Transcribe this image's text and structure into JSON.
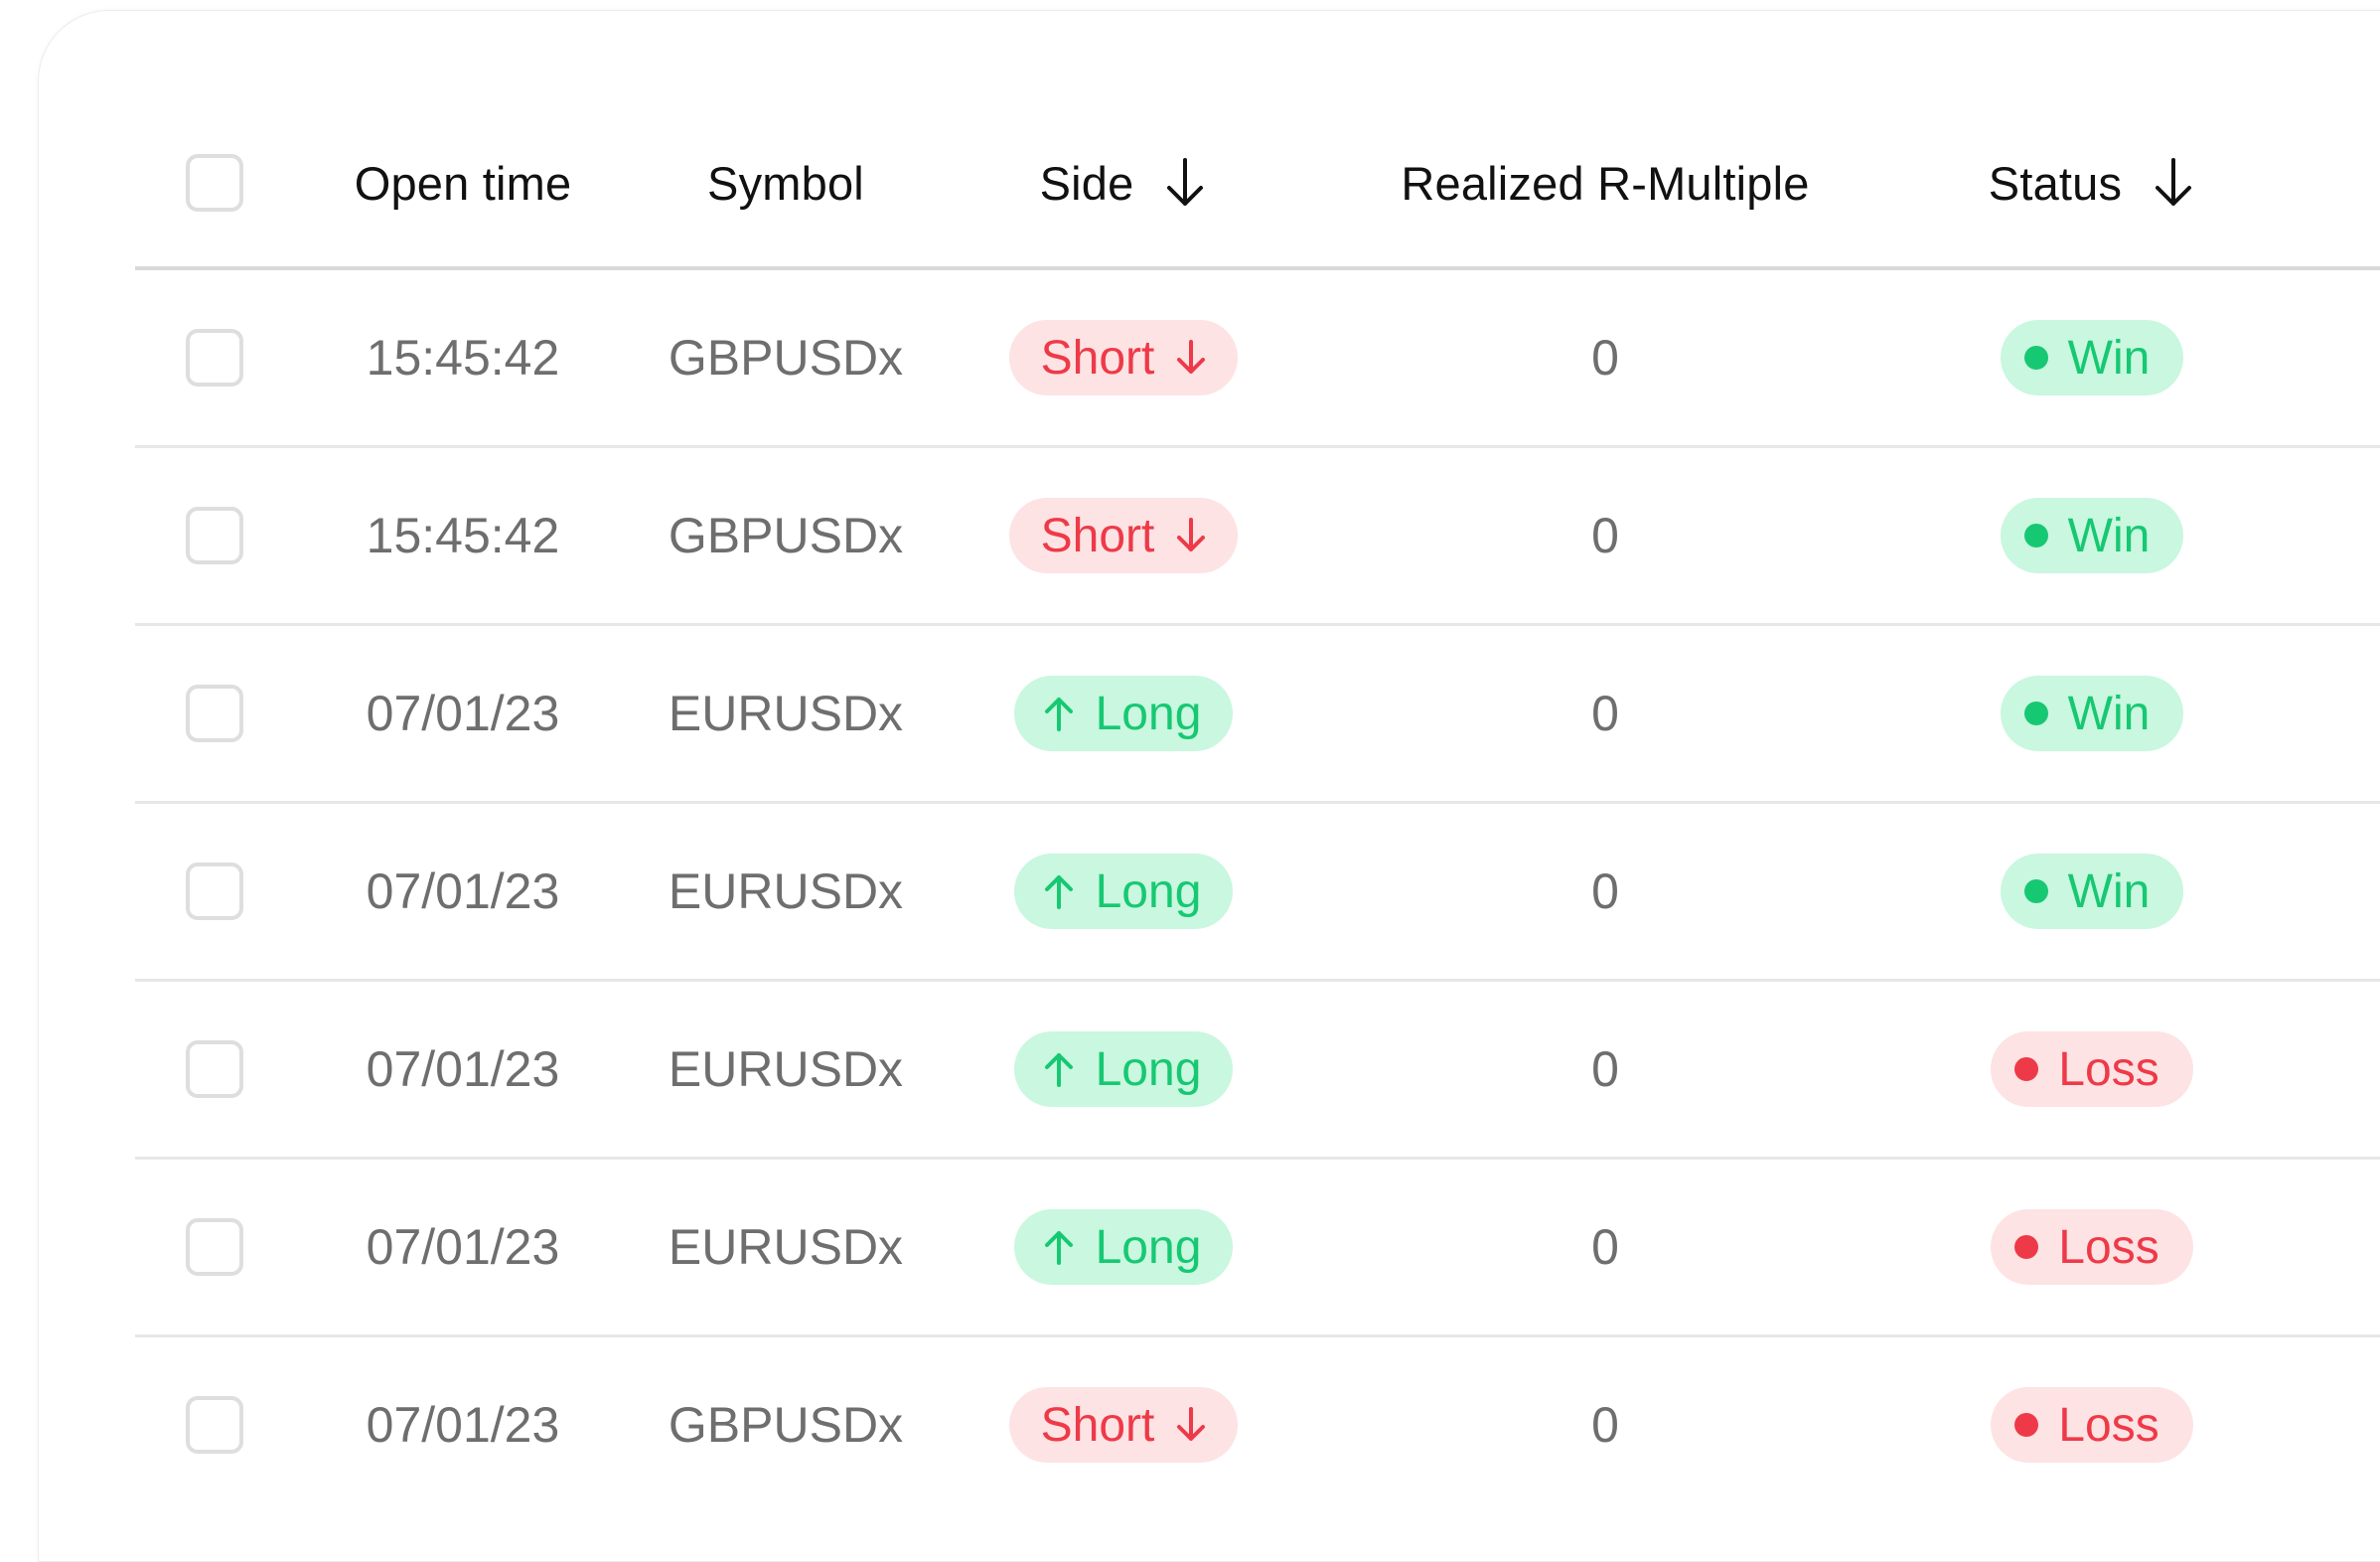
{
  "table": {
    "columns": {
      "open_time": "Open time",
      "symbol": "Symbol",
      "side": "Side",
      "realized_r": "Realized R-Multiple",
      "status": "Status"
    },
    "rows": [
      {
        "open_time": "15:45:42",
        "symbol": "GBPUSDx",
        "side": "Short",
        "r": "0",
        "status": "Win"
      },
      {
        "open_time": "15:45:42",
        "symbol": "GBPUSDx",
        "side": "Short",
        "r": "0",
        "status": "Win"
      },
      {
        "open_time": "07/01/23",
        "symbol": "EURUSDx",
        "side": "Long",
        "r": "0",
        "status": "Win"
      },
      {
        "open_time": "07/01/23",
        "symbol": "EURUSDx",
        "side": "Long",
        "r": "0",
        "status": "Win"
      },
      {
        "open_time": "07/01/23",
        "symbol": "EURUSDx",
        "side": "Long",
        "r": "0",
        "status": "Loss"
      },
      {
        "open_time": "07/01/23",
        "symbol": "EURUSDx",
        "side": "Long",
        "r": "0",
        "status": "Loss"
      },
      {
        "open_time": "07/01/23",
        "symbol": "GBPUSDx",
        "side": "Short",
        "r": "0",
        "status": "Loss"
      }
    ]
  },
  "icons": {
    "sort": "arrow-down-icon",
    "short": "arrow-down-icon",
    "long": "arrow-up-icon",
    "status": "dot-icon"
  },
  "colors": {
    "red": "#ee3a48",
    "red_bg": "#fde3e4",
    "green": "#17c872",
    "green_bg": "#c9f7df"
  }
}
